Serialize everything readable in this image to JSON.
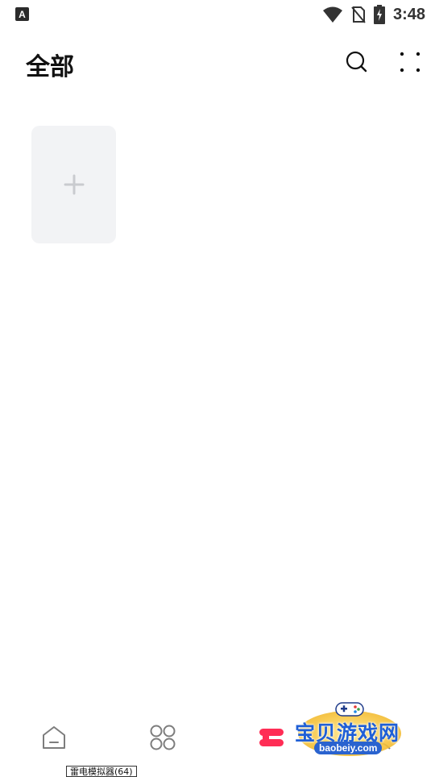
{
  "status_bar": {
    "left_icon_letter": "A",
    "time": "3:48"
  },
  "header": {
    "title": "全部"
  },
  "main": {
    "add_card_icon": "plus-icon"
  },
  "bottom_nav": {
    "items": [
      {
        "icon": "home-icon"
      },
      {
        "icon": "apps-grid-icon"
      },
      {
        "icon": "library-icon"
      },
      {
        "icon": "profile-icon"
      }
    ],
    "tooltip": "雷电模拟器(64)"
  },
  "watermark": {
    "title": "宝贝游戏网",
    "url": "baobeiy.com"
  },
  "colors": {
    "accent": "#ff2d55",
    "card_bg": "#f2f3f5",
    "icon_gray": "#7d7d7d"
  }
}
